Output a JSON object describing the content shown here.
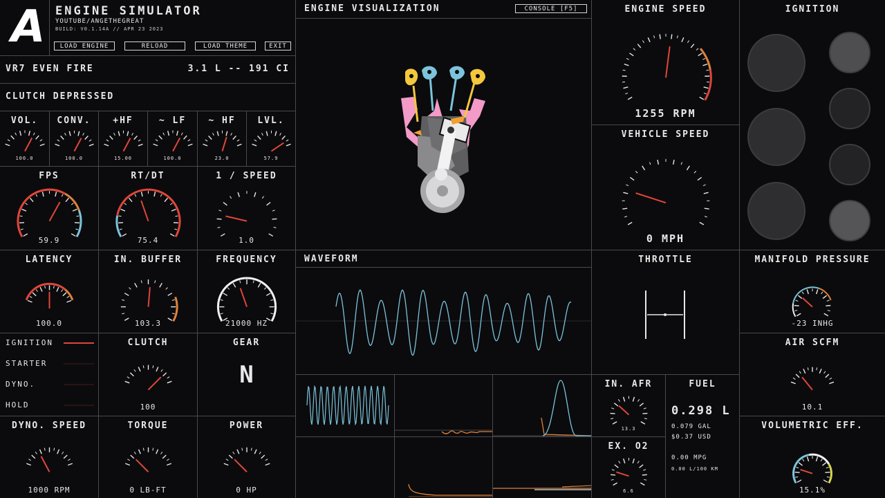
{
  "header": {
    "logo_letter": "A",
    "title": "ENGINE SIMULATOR",
    "subtitle": "YOUTUBE/ANGETHEGREAT",
    "build": "BUILD: V0.1.14A // APR 23 2023",
    "buttons": {
      "load_engine": "LOAD ENGINE",
      "reload": "RELOAD",
      "load_theme": "LOAD THEME",
      "exit": "EXIT"
    }
  },
  "engine_info": {
    "name": "VR7 EVEN FIRE",
    "displacement": "3.1 L -- 191 CI"
  },
  "clutch_status": "CLUTCH DEPRESSED",
  "audio_meters": [
    {
      "label": "VOL.",
      "value": "100.0",
      "level": 0.7
    },
    {
      "label": "CONV.",
      "value": "100.0",
      "level": 0.7
    },
    {
      "label": "+HF",
      "value": "15.00",
      "level": 0.7
    },
    {
      "label": "~ LF",
      "value": "100.0",
      "level": 0.7
    },
    {
      "label": "~ HF",
      "value": "23.0",
      "level": 0.62
    },
    {
      "label": "LVL.",
      "value": "57.9",
      "level": 0.9
    }
  ],
  "perf_gauges": [
    {
      "label": "FPS",
      "value": "59.9",
      "level": 0.62
    },
    {
      "label": "RT/DT",
      "value": "75.4",
      "level": 0.42
    },
    {
      "label": "1 / SPEED",
      "value": "1.0",
      "level": 0.18
    }
  ],
  "latency_gauges": [
    {
      "label": "LATENCY",
      "value": "100.0",
      "level": 0.5
    },
    {
      "label": "IN. BUFFER",
      "value": "103.3",
      "level": 0.52
    },
    {
      "label": "FREQUENCY",
      "value": "21000 HZ",
      "level": 0.42
    }
  ],
  "status_list": [
    {
      "label": "IGNITION",
      "active": true
    },
    {
      "label": "STARTER",
      "active": false
    },
    {
      "label": "DYNO.",
      "active": false
    },
    {
      "label": "HOLD",
      "active": false
    }
  ],
  "clutch_gauge": {
    "label": "CLUTCH",
    "value": "100",
    "level": 0.82
  },
  "gear": {
    "label": "GEAR",
    "value": "N"
  },
  "dyno_gauges": [
    {
      "label": "DYNO. SPEED",
      "value": "1000 RPM",
      "level": 0.3
    },
    {
      "label": "TORQUE",
      "value": "0 LB-FT",
      "level": 0.18
    },
    {
      "label": "POWER",
      "value": "0 HP",
      "level": 0.18
    }
  ],
  "visualization": {
    "title": "ENGINE VISUALIZATION",
    "console_button": "CONSOLE [F5]"
  },
  "engine_speed": {
    "label": "ENGINE SPEED",
    "value": "1255 RPM",
    "level": 0.53
  },
  "vehicle_speed": {
    "label": "VEHICLE SPEED",
    "value": "0 MPH",
    "level": 0.2
  },
  "ignition": {
    "title": "IGNITION"
  },
  "waveform": {
    "title": "WAVEFORM"
  },
  "throttle": {
    "title": "THROTTLE"
  },
  "manifold_pressure": {
    "label": "MANIFOLD PRESSURE",
    "value": "-23 INHG",
    "level": 0.3
  },
  "air_scfm": {
    "label": "AIR SCFM",
    "value": "10.1",
    "level": 0.22
  },
  "volumetric_eff": {
    "label": "VOLUMETRIC EFF.",
    "value": "15.1%",
    "level": 0.2
  },
  "in_afr": {
    "label": "IN. AFR",
    "value": "13.3",
    "level": 0.3
  },
  "ex_o2": {
    "label": "EX. O2",
    "value": "6.6",
    "level": 0.2
  },
  "fuel": {
    "label": "FUEL",
    "liters": "0.298 L",
    "gallons": "0.079 GAL",
    "cost": "$0.37 USD",
    "mpg": "0.00 MPG",
    "l100": "0.00 L/100 KM"
  },
  "colors": {
    "accent_red": "#e0463a",
    "accent_blue": "#7cc4dc",
    "accent_orange": "#e0823a",
    "grid": "#4a4a4e"
  }
}
